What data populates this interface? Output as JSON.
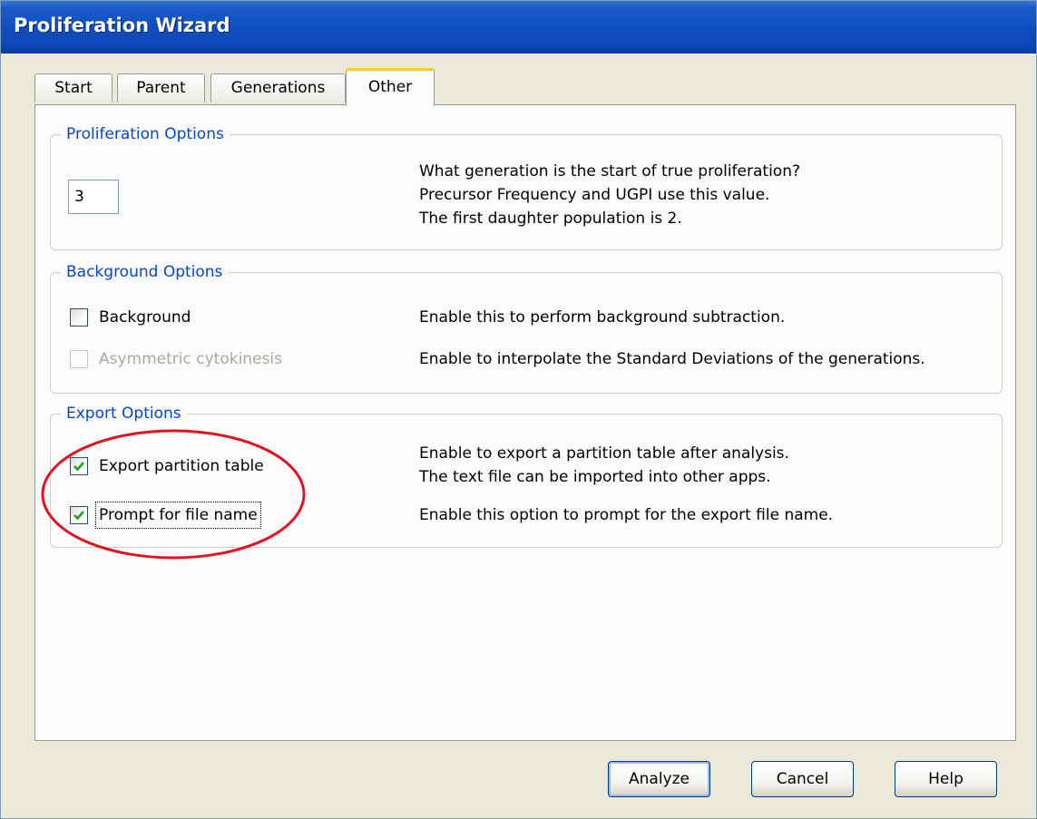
{
  "window": {
    "title": "Proliferation Wizard"
  },
  "tabs": [
    {
      "label": "Start"
    },
    {
      "label": "Parent"
    },
    {
      "label": "Generations"
    },
    {
      "label": "Other",
      "active": true
    }
  ],
  "proliferation_options": {
    "title": "Proliferation Options",
    "value": "3",
    "description": [
      "What generation is the start of true proliferation?",
      "Precursor Frequency and UGPI use this value.",
      "The first daughter population is 2."
    ]
  },
  "background_options": {
    "title": "Background Options",
    "background": {
      "label": "Background",
      "checked": false,
      "description": "Enable this to perform background subtraction."
    },
    "asymmetric": {
      "label": "Asymmetric cytokinesis",
      "checked": false,
      "enabled": false,
      "description": "Enable to interpolate the Standard Deviations of the generations."
    }
  },
  "export_options": {
    "title": "Export Options",
    "export_table": {
      "label": "Export partition table",
      "checked": true,
      "description": [
        "Enable to export a partition table after analysis.",
        "The text file can be imported into other apps."
      ]
    },
    "prompt_file": {
      "label": "Prompt for file name",
      "checked": true,
      "description": "Enable this option to prompt for the export file name."
    }
  },
  "buttons": {
    "analyze": "Analyze",
    "cancel": "Cancel",
    "help": "Help"
  },
  "colors": {
    "titlebar": "#0f4fc1",
    "group_title": "#0046d5",
    "active_tab_accent": "#ffc83c",
    "annotation": "#e0141e",
    "check": "#21a121"
  }
}
